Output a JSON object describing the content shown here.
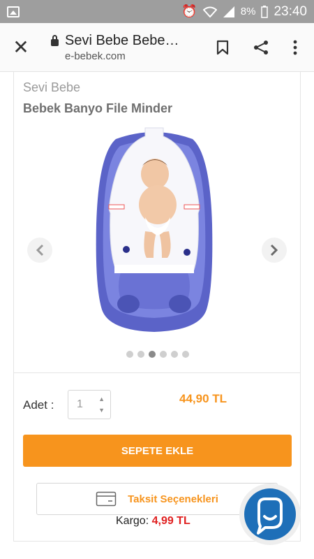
{
  "status_bar": {
    "battery": "8%",
    "time": "23:40"
  },
  "browser": {
    "page_title": "Sevi Bebe Bebe…",
    "domain": "e-bebek.com"
  },
  "product": {
    "brand": "Sevi Bebe",
    "title": "Bebek Banyo File Minder",
    "image_dots_count": 6,
    "active_dot_index": 2,
    "quantity_label": "Adet :",
    "quantity_value": "1",
    "price": "44,90 TL",
    "add_to_cart_label": "SEPETE EKLE",
    "installments_label": "Taksit Seçenekleri",
    "cargo_label": "Kargo:",
    "cargo_amount": "4,99 TL"
  },
  "colors": {
    "accent": "#f7941d",
    "cargo_price": "#e02020",
    "chat": "#1e6fb8"
  },
  "icons": {
    "close": "close-icon",
    "lock": "lock-icon",
    "bookmark": "bookmark-icon",
    "share": "share-icon",
    "more": "more-vertical-icon",
    "chat": "chat-support-icon",
    "credit_card": "credit-card-icon"
  }
}
